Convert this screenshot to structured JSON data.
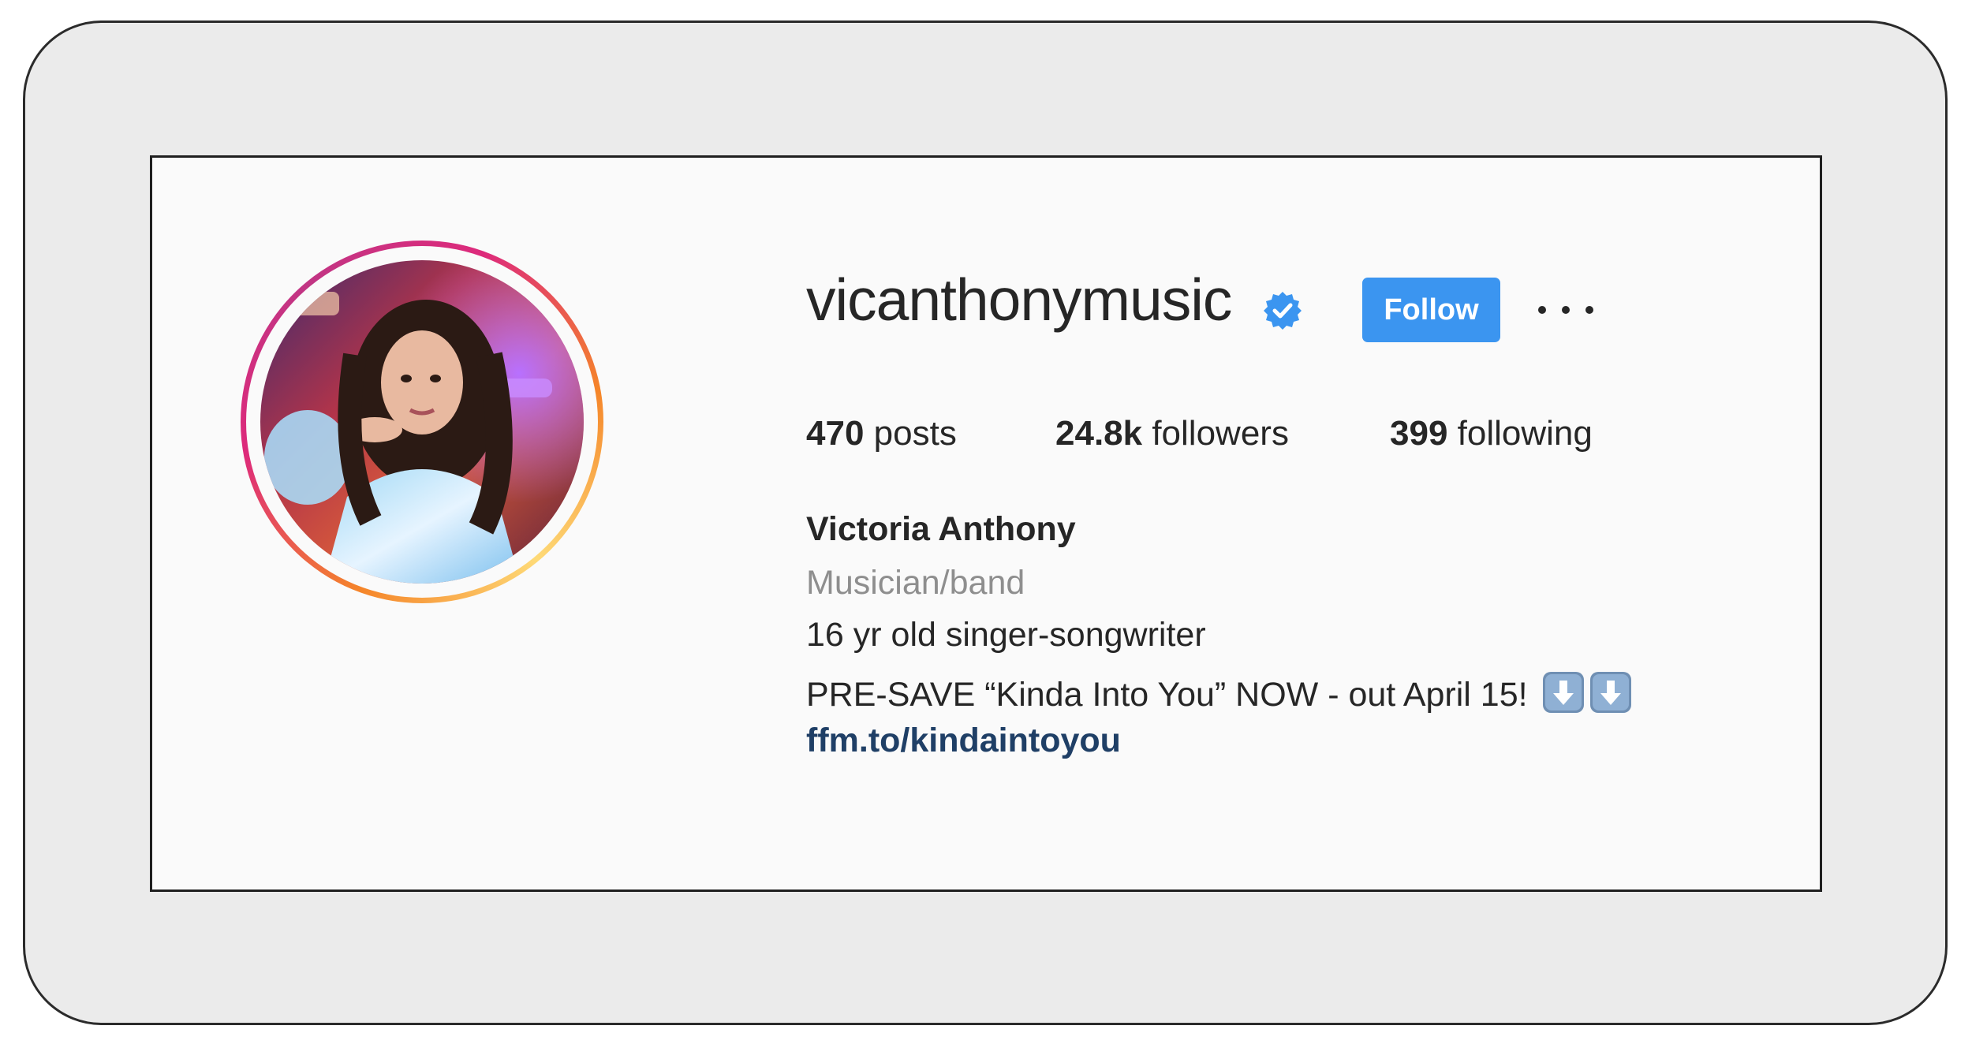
{
  "profile": {
    "username": "vicanthonymusic",
    "verified_icon": "verified-badge-icon",
    "follow_label": "Follow",
    "more_icon": "more-options-icon",
    "accent_color": "#3b95f0"
  },
  "stats": {
    "posts_count": "470",
    "posts_label": " posts",
    "followers_count": "24.8k",
    "followers_label": " followers",
    "following_count": "399",
    "following_label": " following"
  },
  "bio": {
    "full_name": "Victoria Anthony",
    "category": "Musician/band",
    "line1": "16 yr old singer-songwriter",
    "line2": "PRE-SAVE “Kinda Into You” NOW - out April 15! ",
    "line2_icons": [
      "down-arrow-icon",
      "down-arrow-icon"
    ],
    "link": "ffm.to/kindaintoyou"
  }
}
